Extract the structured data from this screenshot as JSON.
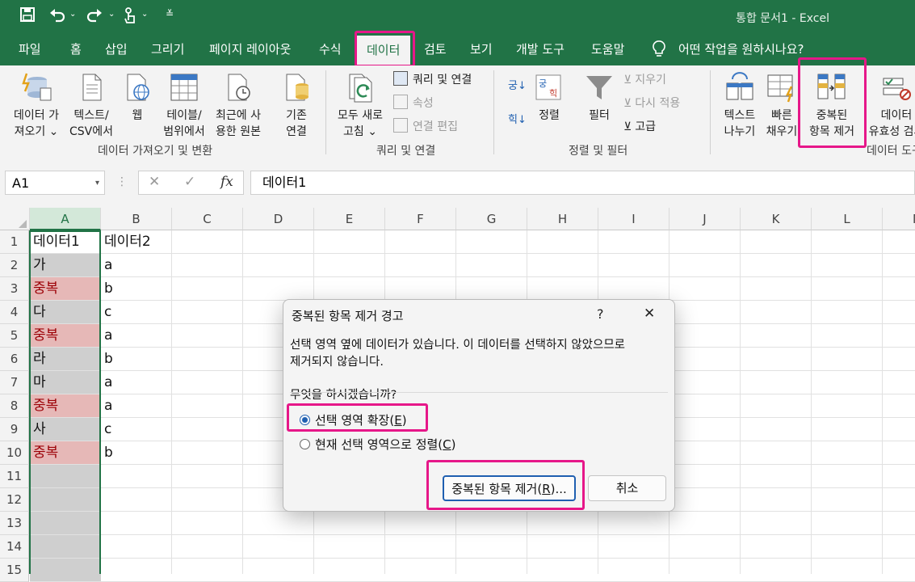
{
  "window": {
    "title": "통합 문서1  -  Excel"
  },
  "colors": {
    "excel_green": "#217346",
    "highlight": "#e61789",
    "duplicate_fill": "#e6b8b7",
    "duplicate_text": "#9c0006"
  },
  "qat": {
    "save_icon": "save-icon",
    "undo_icon": "undo-icon",
    "redo_icon": "redo-icon",
    "touch_icon": "touch-mode-icon",
    "customize_icon": "customize-qat-icon"
  },
  "tabs": [
    "파일",
    "홈",
    "삽입",
    "그리기",
    "페이지 레이아웃",
    "수식",
    "데이터",
    "검토",
    "보기",
    "개발 도구",
    "도움말"
  ],
  "active_tab": "데이터",
  "tell_me": "어떤 작업을 원하시나요?",
  "ribbon": {
    "get_data": {
      "l1": "데이터 가",
      "l2": "져오기 ⌄"
    },
    "from_csv": {
      "l1": "텍스트/",
      "l2": "CSV에서"
    },
    "web": {
      "l1": "웹"
    },
    "table_range": {
      "l1": "테이블/",
      "l2": "범위에서"
    },
    "recent": {
      "l1": "최근에 사",
      "l2": "용한 원본"
    },
    "existing": {
      "l1": "기존",
      "l2": "연결"
    },
    "group1": "데이터 가져오기 및 변환",
    "refresh": {
      "l1": "모두 새로",
      "l2": "고침 ⌄"
    },
    "queries": "쿼리 및 연결",
    "properties": "속성",
    "edit_links": "연결 편집",
    "group2": "쿼리 및 연결",
    "sort": "정렬",
    "filter": "필터",
    "clear": "지우기",
    "reapply": "다시 적용",
    "advanced": "고급",
    "group3": "정렬 및 필터",
    "text_to_columns": {
      "l1": "텍스트",
      "l2": "나누기"
    },
    "flash_fill": {
      "l1": "빠른",
      "l2": "채우기"
    },
    "remove_dup": {
      "l1": "중복된",
      "l2": "항목 제거"
    },
    "validation": {
      "l1": "데이터",
      "l2": "유효성 검사"
    },
    "group4": "데이터 도구"
  },
  "formula_bar": {
    "name_box": "A1",
    "cancel": "✕",
    "enter": "✓",
    "fx": "fx",
    "content": "데이터1"
  },
  "columns": [
    "A",
    "B",
    "C",
    "D",
    "E",
    "F",
    "G",
    "H",
    "I",
    "J",
    "K",
    "L",
    "M"
  ],
  "rows": [
    "1",
    "2",
    "3",
    "4",
    "5",
    "6",
    "7",
    "8",
    "9",
    "10",
    "11",
    "12",
    "13",
    "14",
    "15"
  ],
  "cells": {
    "a": [
      "데이터1",
      "가",
      "중복",
      "다",
      "중복",
      "라",
      "마",
      "중복",
      "사",
      "중복"
    ],
    "b": [
      "데이터2",
      "a",
      "b",
      "c",
      "a",
      "b",
      "a",
      "a",
      "c",
      "b"
    ]
  },
  "dialog": {
    "title": "중복된 항목 제거 경고",
    "help": "?",
    "close": "✕",
    "message_l1": "선택 영역 옆에 데이터가 있습니다. 이 데이터를 선택하지 않았으므로",
    "message_l2": "제거되지 않습니다.",
    "question": "무엇을 하시겠습니까?",
    "option1_text": "선택 영역 확장(",
    "option1_key": "E",
    "option2_text": "현재 선택 영역으로 정렬(",
    "option2_key": "C",
    "remove_text": "중복된 항목 제거(",
    "remove_key": "R",
    "remove_tail": ")...",
    "paren": ")",
    "cancel": "취소"
  }
}
